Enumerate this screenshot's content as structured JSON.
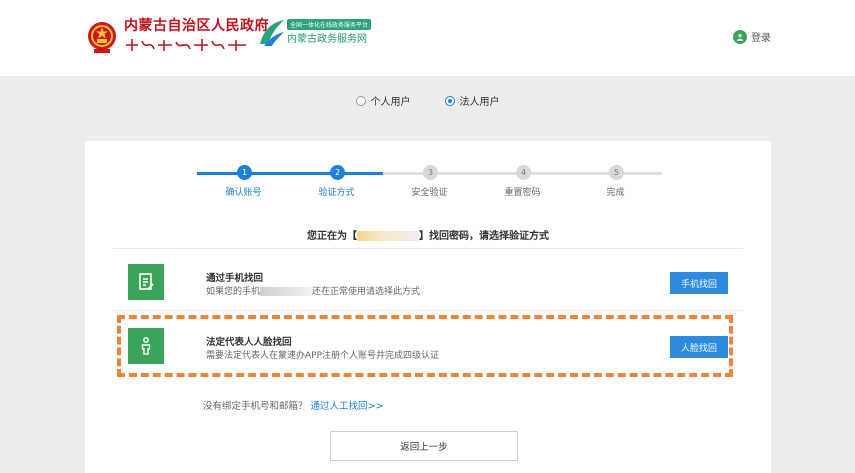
{
  "header": {
    "gov_title": "内蒙古自治区人民政府",
    "portal_subtitle": "全国一体化在线政务服务平台",
    "portal_title": "内蒙古政务服务网",
    "login_label": "登录"
  },
  "user_type": {
    "options": [
      {
        "label": "个人用户",
        "selected": false
      },
      {
        "label": "法人用户",
        "selected": true
      }
    ]
  },
  "steps": [
    {
      "num": "1",
      "label": "确认账号",
      "status": "done"
    },
    {
      "num": "2",
      "label": "验证方式",
      "status": "done"
    },
    {
      "num": "3",
      "label": "安全验证",
      "status": "pending"
    },
    {
      "num": "4",
      "label": "重置密码",
      "status": "pending"
    },
    {
      "num": "5",
      "label": "完成",
      "status": "pending"
    }
  ],
  "prompt": {
    "prefix": "您正在为【",
    "suffix": "】找回密码，请选择验证方式"
  },
  "methods": [
    {
      "title": "通过手机找回",
      "desc_prefix": "如果您的手机",
      "desc_suffix": "还在正常使用请选择此方式",
      "button": "手机找回",
      "icon": "document-icon"
    },
    {
      "title": "法定代表人人脸找回",
      "desc": "需要法定代表人在蒙速办APP注册个人账号并完成四级认证",
      "button": "人脸找回",
      "icon": "person-icon"
    }
  ],
  "manual": {
    "text": "没有绑定手机号和邮箱？",
    "link": "通过人工找回>>"
  },
  "back_button": "返回上一步",
  "colors": {
    "accent_blue": "#1e7fd8",
    "button_blue": "#2d8be0",
    "icon_green": "#3aa55a",
    "highlight_orange": "#f0843a",
    "gov_red": "#c1121c"
  }
}
